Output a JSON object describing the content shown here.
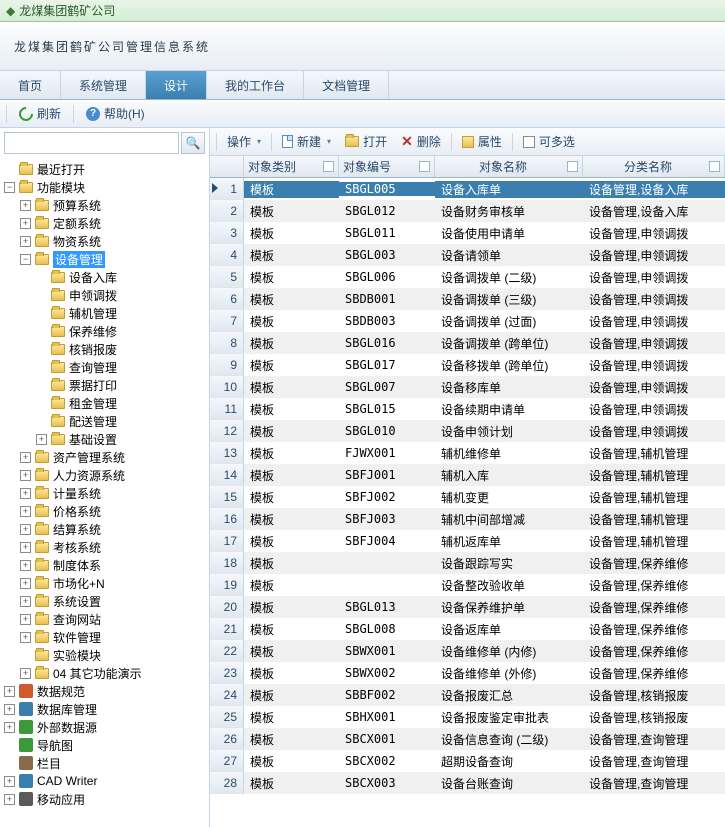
{
  "titlebar": {
    "text": "龙煤集团鹤矿公司"
  },
  "header": {
    "title": "龙煤集团鹤矿公司管理信息系统"
  },
  "tabs": {
    "items": [
      "首页",
      "系统管理",
      "设计",
      "我的工作台",
      "文档管理"
    ],
    "active_index": 2
  },
  "top_toolbar": {
    "refresh": "刷新",
    "help": "帮助(H)"
  },
  "search": {
    "placeholder": ""
  },
  "tree": {
    "nodes": [
      {
        "exp": "",
        "indent": 1,
        "icon": "folder",
        "label": "最近打开",
        "sel": false
      },
      {
        "exp": "-",
        "indent": 1,
        "icon": "folder",
        "label": "功能模块",
        "sel": false
      },
      {
        "exp": "+",
        "indent": 2,
        "icon": "folder",
        "label": "预算系统",
        "sel": false
      },
      {
        "exp": "+",
        "indent": 2,
        "icon": "folder",
        "label": "定额系统",
        "sel": false
      },
      {
        "exp": "+",
        "indent": 2,
        "icon": "folder",
        "label": "物资系统",
        "sel": false
      },
      {
        "exp": "-",
        "indent": 2,
        "icon": "folder",
        "label": "设备管理",
        "sel": true
      },
      {
        "exp": "",
        "indent": 3,
        "icon": "folder",
        "label": "设备入库",
        "sel": false
      },
      {
        "exp": "",
        "indent": 3,
        "icon": "folder",
        "label": "申领调拨",
        "sel": false
      },
      {
        "exp": "",
        "indent": 3,
        "icon": "folder",
        "label": "辅机管理",
        "sel": false
      },
      {
        "exp": "",
        "indent": 3,
        "icon": "folder",
        "label": "保养维修",
        "sel": false
      },
      {
        "exp": "",
        "indent": 3,
        "icon": "folder",
        "label": "核销报废",
        "sel": false
      },
      {
        "exp": "",
        "indent": 3,
        "icon": "folder",
        "label": "查询管理",
        "sel": false
      },
      {
        "exp": "",
        "indent": 3,
        "icon": "folder",
        "label": "票据打印",
        "sel": false
      },
      {
        "exp": "",
        "indent": 3,
        "icon": "folder",
        "label": "租金管理",
        "sel": false
      },
      {
        "exp": "",
        "indent": 3,
        "icon": "folder",
        "label": "配送管理",
        "sel": false
      },
      {
        "exp": "+",
        "indent": 3,
        "icon": "folder",
        "label": "基础设置",
        "sel": false
      },
      {
        "exp": "+",
        "indent": 2,
        "icon": "folder",
        "label": "资产管理系统",
        "sel": false
      },
      {
        "exp": "+",
        "indent": 2,
        "icon": "folder",
        "label": "人力资源系统",
        "sel": false
      },
      {
        "exp": "+",
        "indent": 2,
        "icon": "folder",
        "label": "计量系统",
        "sel": false
      },
      {
        "exp": "+",
        "indent": 2,
        "icon": "folder",
        "label": "价格系统",
        "sel": false
      },
      {
        "exp": "+",
        "indent": 2,
        "icon": "folder",
        "label": "结算系统",
        "sel": false
      },
      {
        "exp": "+",
        "indent": 2,
        "icon": "folder",
        "label": "考核系统",
        "sel": false
      },
      {
        "exp": "+",
        "indent": 2,
        "icon": "folder",
        "label": "制度体系",
        "sel": false
      },
      {
        "exp": "+",
        "indent": 2,
        "icon": "folder",
        "label": "市场化+N",
        "sel": false
      },
      {
        "exp": "+",
        "indent": 2,
        "icon": "folder",
        "label": "系统设置",
        "sel": false
      },
      {
        "exp": "+",
        "indent": 2,
        "icon": "folder",
        "label": "查询网站",
        "sel": false
      },
      {
        "exp": "+",
        "indent": 2,
        "icon": "folder",
        "label": "软件管理",
        "sel": false
      },
      {
        "exp": "",
        "indent": 2,
        "icon": "folder",
        "label": "实验模块",
        "sel": false
      },
      {
        "exp": "+",
        "indent": 2,
        "icon": "folder",
        "label": "04 其它功能演示",
        "sel": false
      },
      {
        "exp": "+",
        "indent": 1,
        "icon": "spec",
        "label": "数据规范",
        "sel": false,
        "color": "#d05a30"
      },
      {
        "exp": "+",
        "indent": 1,
        "icon": "spec",
        "label": "数据库管理",
        "sel": false,
        "color": "#3a7fb0"
      },
      {
        "exp": "+",
        "indent": 1,
        "icon": "spec",
        "label": "外部数据源",
        "sel": false,
        "color": "#3a9a3a"
      },
      {
        "exp": "",
        "indent": 1,
        "icon": "spec",
        "label": "导航图",
        "sel": false,
        "color": "#3a9a3a"
      },
      {
        "exp": "",
        "indent": 1,
        "icon": "spec",
        "label": "栏目",
        "sel": false,
        "color": "#8a6a4a"
      },
      {
        "exp": "+",
        "indent": 1,
        "icon": "spec",
        "label": "CAD Writer",
        "sel": false,
        "color": "#3a7fb0"
      },
      {
        "exp": "+",
        "indent": 1,
        "icon": "spec",
        "label": "移动应用",
        "sel": false,
        "color": "#5a5a5a"
      }
    ]
  },
  "grid_toolbar": {
    "operate": "操作",
    "new": "新建",
    "open": "打开",
    "delete": "删除",
    "props": "属性",
    "multi": "可多选"
  },
  "grid": {
    "columns": [
      "对象类别",
      "对象编号",
      "对象名称",
      "分类名称"
    ],
    "rows": [
      {
        "n": 1,
        "type": "模板",
        "code": "SBGL005",
        "name": "设备入库单",
        "cat": "设备管理,设备入库",
        "sel": true
      },
      {
        "n": 2,
        "type": "模板",
        "code": "SBGL012",
        "name": "设备财务审核单",
        "cat": "设备管理,设备入库"
      },
      {
        "n": 3,
        "type": "模板",
        "code": "SBGL011",
        "name": "设备使用申请单",
        "cat": "设备管理,申领调拨"
      },
      {
        "n": 4,
        "type": "模板",
        "code": "SBGL003",
        "name": "设备请领单",
        "cat": "设备管理,申领调拨"
      },
      {
        "n": 5,
        "type": "模板",
        "code": "SBGL006",
        "name": "设备调拨单 (二级)",
        "cat": "设备管理,申领调拨"
      },
      {
        "n": 6,
        "type": "模板",
        "code": "SBDB001",
        "name": "设备调拨单 (三级)",
        "cat": "设备管理,申领调拨"
      },
      {
        "n": 7,
        "type": "模板",
        "code": "SBDB003",
        "name": "设备调拨单 (过面)",
        "cat": "设备管理,申领调拨"
      },
      {
        "n": 8,
        "type": "模板",
        "code": "SBGL016",
        "name": "设备调拨单 (跨单位)",
        "cat": "设备管理,申领调拨"
      },
      {
        "n": 9,
        "type": "模板",
        "code": "SBGL017",
        "name": "设备移拨单 (跨单位)",
        "cat": "设备管理,申领调拨"
      },
      {
        "n": 10,
        "type": "模板",
        "code": "SBGL007",
        "name": "设备移库单",
        "cat": "设备管理,申领调拨"
      },
      {
        "n": 11,
        "type": "模板",
        "code": "SBGL015",
        "name": "设备续期申请单",
        "cat": "设备管理,申领调拨"
      },
      {
        "n": 12,
        "type": "模板",
        "code": "SBGL010",
        "name": "设备申领计划",
        "cat": "设备管理,申领调拨"
      },
      {
        "n": 13,
        "type": "模板",
        "code": "FJWX001",
        "name": "辅机维修单",
        "cat": "设备管理,辅机管理"
      },
      {
        "n": 14,
        "type": "模板",
        "code": "SBFJ001",
        "name": "辅机入库",
        "cat": "设备管理,辅机管理"
      },
      {
        "n": 15,
        "type": "模板",
        "code": "SBFJ002",
        "name": "辅机变更",
        "cat": "设备管理,辅机管理"
      },
      {
        "n": 16,
        "type": "模板",
        "code": "SBFJ003",
        "name": "辅机中间部增减",
        "cat": "设备管理,辅机管理"
      },
      {
        "n": 17,
        "type": "模板",
        "code": "SBFJ004",
        "name": "辅机返库单",
        "cat": "设备管理,辅机管理"
      },
      {
        "n": 18,
        "type": "模板",
        "code": "",
        "name": "设备跟踪写实",
        "cat": "设备管理,保养维修"
      },
      {
        "n": 19,
        "type": "模板",
        "code": "",
        "name": "设备整改验收单",
        "cat": "设备管理,保养维修"
      },
      {
        "n": 20,
        "type": "模板",
        "code": "SBGL013",
        "name": "设备保养维护单",
        "cat": "设备管理,保养维修"
      },
      {
        "n": 21,
        "type": "模板",
        "code": "SBGL008",
        "name": "设备返库单",
        "cat": "设备管理,保养维修"
      },
      {
        "n": 22,
        "type": "模板",
        "code": "SBWX001",
        "name": "设备维修单 (内修)",
        "cat": "设备管理,保养维修"
      },
      {
        "n": 23,
        "type": "模板",
        "code": "SBWX002",
        "name": "设备维修单 (外修)",
        "cat": "设备管理,保养维修"
      },
      {
        "n": 24,
        "type": "模板",
        "code": "SBBF002",
        "name": "设备报废汇总",
        "cat": "设备管理,核销报废"
      },
      {
        "n": 25,
        "type": "模板",
        "code": "SBHX001",
        "name": "设备报废鉴定审批表",
        "cat": "设备管理,核销报废"
      },
      {
        "n": 26,
        "type": "模板",
        "code": "SBCX001",
        "name": "设备信息查询 (二级)",
        "cat": "设备管理,查询管理"
      },
      {
        "n": 27,
        "type": "模板",
        "code": "SBCX002",
        "name": "超期设备查询",
        "cat": "设备管理,查询管理"
      },
      {
        "n": 28,
        "type": "模板",
        "code": "SBCX003",
        "name": "设备台账查询",
        "cat": "设备管理,查询管理"
      }
    ]
  }
}
